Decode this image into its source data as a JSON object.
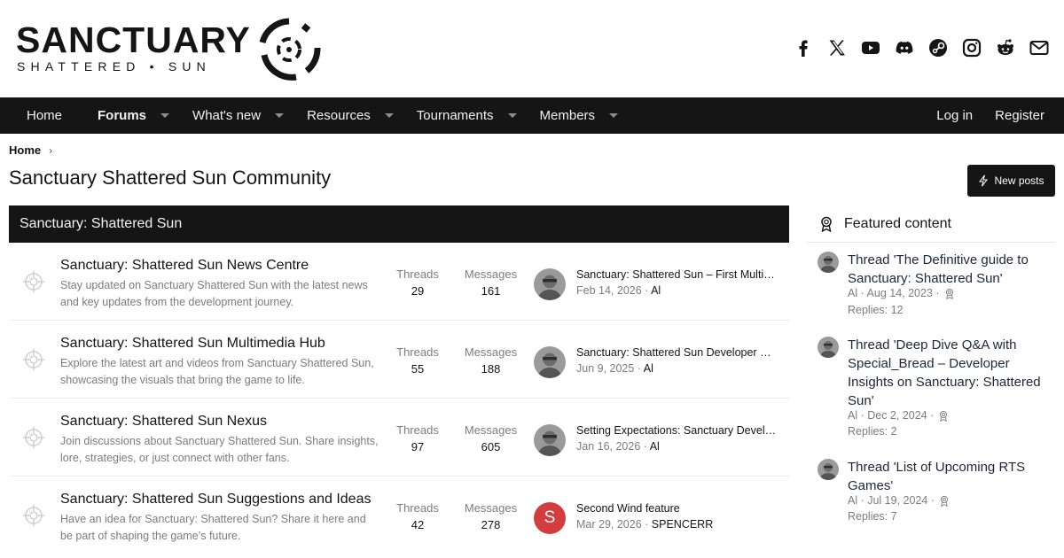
{
  "brand": {
    "wordmark": "SANCTUARY",
    "subline": "SHATTERED • SUN"
  },
  "social_icons": [
    "facebook-icon",
    "x-icon",
    "youtube-icon",
    "discord-icon",
    "steam-icon",
    "instagram-icon",
    "reddit-icon",
    "email-icon"
  ],
  "nav": {
    "items": [
      {
        "label": "Home",
        "dropdown": false,
        "active": false
      },
      {
        "label": "Forums",
        "dropdown": true,
        "active": true
      },
      {
        "label": "What's new",
        "dropdown": true,
        "active": false
      },
      {
        "label": "Resources",
        "dropdown": true,
        "active": false
      },
      {
        "label": "Tournaments",
        "dropdown": true,
        "active": false
      },
      {
        "label": "Members",
        "dropdown": true,
        "active": false
      }
    ],
    "login": "Log in",
    "register": "Register"
  },
  "breadcrumb": {
    "home": "Home",
    "chevron": "›"
  },
  "page": {
    "title": "Sanctuary Shattered Sun Community",
    "new_posts": "New posts"
  },
  "category": {
    "title": "Sanctuary: Shattered Sun",
    "forums": [
      {
        "title": "Sanctuary: Shattered Sun News Centre",
        "description": "Stay updated on Sanctuary Shattered Sun with the latest news and key updates from the development journey.",
        "threads_label": "Threads",
        "threads": "29",
        "messages_label": "Messages",
        "messages": "161",
        "last_post": {
          "title": "Sanctuary: Shattered Sun – First Multiplayer Gameplay Showcase",
          "date": "Feb 14, 2026",
          "sep": " · ",
          "user": "Al",
          "avatar": "photo"
        }
      },
      {
        "title": "Sanctuary: Shattered Sun Multimedia Hub",
        "description": "Explore the latest art and videos from Sanctuary Shattered Sun, showcasing the visuals that bring the game to life.",
        "threads_label": "Threads",
        "threads": "55",
        "messages_label": "Messages",
        "messages": "188",
        "last_post": {
          "title": "Sanctuary: Shattered Sun Developer Update Video",
          "date": "Jun 9, 2025",
          "sep": " · ",
          "user": "Al",
          "avatar": "photo"
        }
      },
      {
        "title": "Sanctuary: Shattered Sun Nexus",
        "description": "Join discussions about Sanctuary Shattered Sun. Share insights, lore, strategies, or just connect with other fans.",
        "threads_label": "Threads",
        "threads": "97",
        "messages_label": "Messages",
        "messages": "605",
        "last_post": {
          "title": "Setting Expectations: Sanctuary Development Roadmap",
          "date": "Jan 16, 2026",
          "sep": " · ",
          "user": "Al",
          "avatar": "photo"
        }
      },
      {
        "title": "Sanctuary: Shattered Sun Suggestions and Ideas",
        "description": "Have an idea for Sanctuary: Shattered Sun? Share it here and be part of shaping the game’s future.",
        "threads_label": "Threads",
        "threads": "42",
        "messages_label": "Messages",
        "messages": "278",
        "last_post": {
          "title": "Second Wind feature",
          "date": "Mar 29, 2026",
          "sep": " · ",
          "user": "SPENCERR",
          "avatar": "letter",
          "avatar_letter": "S",
          "avatar_color": "#d33d3d"
        }
      }
    ]
  },
  "featured": {
    "title": "Featured content",
    "items": [
      {
        "title": "Thread 'The Definitive guide to Sanctuary: Shattered Sun'",
        "meta": "Al · Aug 14, 2023 ·",
        "replies": "Replies: 12"
      },
      {
        "title": "Thread 'Deep Dive Q&A with Special_Bread – Developer Insights on Sanctuary: Shattered Sun'",
        "meta": "Al · Dec 2, 2024 ·",
        "replies": "Replies: 2"
      },
      {
        "title": "Thread 'List of Upcoming RTS Games'",
        "meta": "Al · Jul 19, 2024 ·",
        "replies": "Replies: 7"
      }
    ]
  },
  "colors": {
    "nav_bg": "#151515",
    "text": "#141414",
    "muted": "#7c7c7c",
    "featured_link": "#1c2638",
    "avatar_red": "#d33d3d"
  }
}
